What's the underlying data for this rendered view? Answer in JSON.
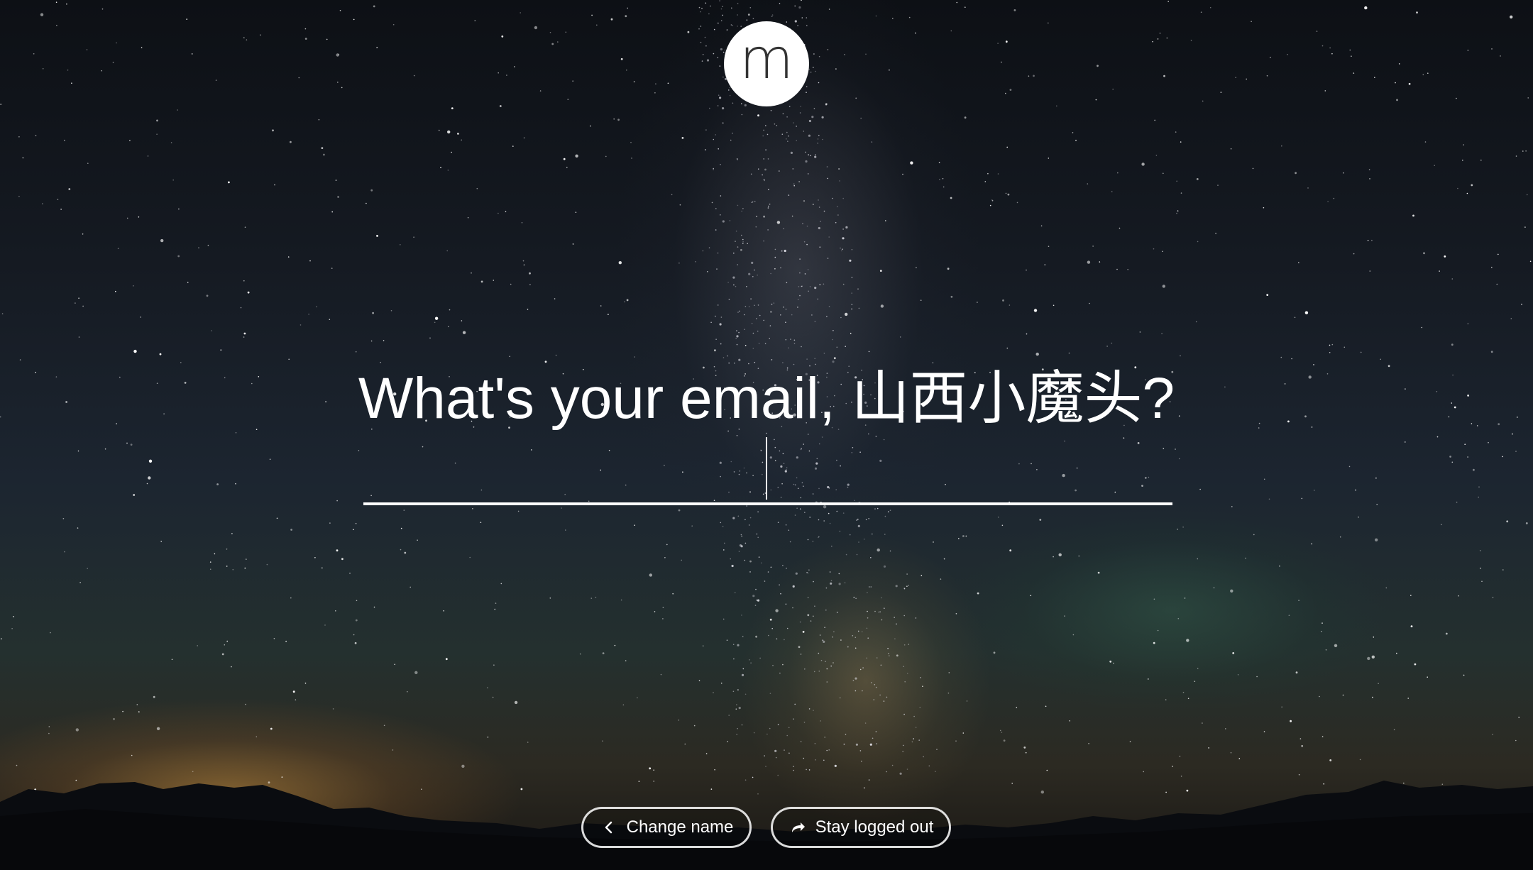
{
  "logo": {
    "letter": "m"
  },
  "prompt": {
    "question": "What's your email, 山西小魔头?"
  },
  "email_field": {
    "value": "",
    "placeholder": ""
  },
  "actions": {
    "change_name": {
      "label": "Change name",
      "icon": "chevron-left-icon"
    },
    "stay_logged_out": {
      "label": "Stay logged out",
      "icon": "forward-arrow-icon"
    }
  },
  "colors": {
    "text": "#ffffff",
    "sky_dark": "#0d1015",
    "horizon_glow": "#f0aa46"
  }
}
